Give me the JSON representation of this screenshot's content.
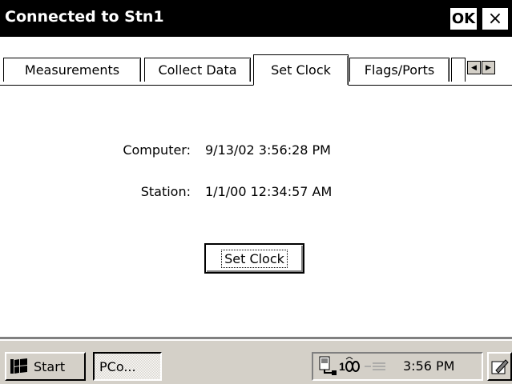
{
  "window": {
    "title": "Connected to Stn1",
    "ok_label": "OK",
    "close_label": "×"
  },
  "tabs": [
    {
      "label": "Measurements",
      "active": false
    },
    {
      "label": "Collect Data",
      "active": false
    },
    {
      "label": "Set Clock",
      "active": true
    },
    {
      "label": "Flags/Ports",
      "active": false
    }
  ],
  "tab_scroll": {
    "left_icon": "arrow-left-icon",
    "right_icon": "arrow-right-icon"
  },
  "clock": {
    "computer_label": "Computer:",
    "computer_value": "9/13/02 3:56:28 PM",
    "station_label": "Station:",
    "station_value": "1/1/00 12:34:57 AM",
    "button_label": "Set Clock"
  },
  "taskbar": {
    "start_label": "Start",
    "task_label": "PCo...",
    "tray_time": "3:56 PM",
    "tray_icons": [
      "connection-icon",
      "battery-icon",
      "signal-icon"
    ],
    "desktop_icon": "pencil-icon"
  },
  "colors": {
    "titlebar": "#000000",
    "taskbar": "#d4d0c8",
    "background": "#ffffff"
  }
}
